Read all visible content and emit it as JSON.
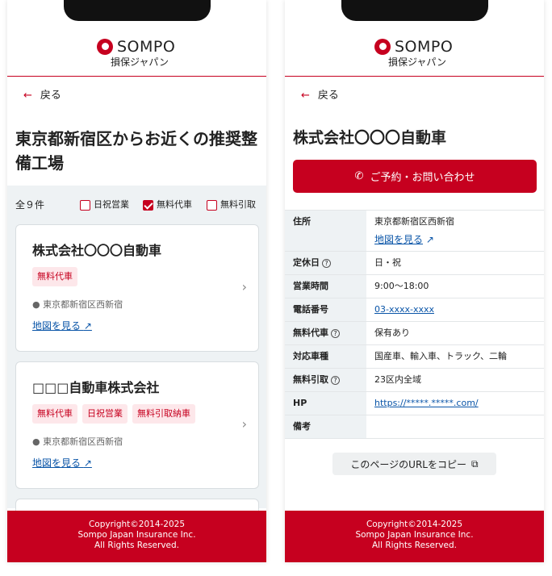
{
  "brand": {
    "name": "SOMPO",
    "sub": "損保ジャパン",
    "accent": "#c6001f"
  },
  "back_label": "戻る",
  "list": {
    "title": "東京都新宿区からお近くの推奨整備工場",
    "count": "全９件",
    "filters": [
      {
        "label": "日祝営業",
        "checked": false
      },
      {
        "label": "無料代車",
        "checked": true
      },
      {
        "label": "無料引取",
        "checked": false
      }
    ],
    "cards": [
      {
        "name": "株式会社〇〇〇自動車",
        "tags": [
          "無料代車"
        ],
        "location": "東京都新宿区西新宿",
        "map_link": "地図を見る"
      },
      {
        "name": "□□□自動車株式会社",
        "tags": [
          "無料代車",
          "日祝営業",
          "無料引取納車"
        ],
        "location": "東京都新宿区西新宿",
        "map_link": "地図を見る"
      }
    ]
  },
  "detail": {
    "title": "株式会社〇〇〇自動車",
    "reserve_button": "ご予約・お問い合わせ",
    "rows": [
      {
        "key": "住所",
        "value": "東京都新宿区西新宿",
        "link": "地図を見る"
      },
      {
        "key": "定休日",
        "value": "日・祝"
      },
      {
        "key": "営業時間",
        "value": "9:00～18:00"
      },
      {
        "key": "電話番号",
        "value": "03-xxxx-xxxx"
      },
      {
        "key": "無料代車",
        "value": "保有あり"
      },
      {
        "key": "対応車種",
        "value": "国産車、輸入車、トラック、二輪"
      },
      {
        "key": "無料引取",
        "value": "23区内全域"
      },
      {
        "key": "HP",
        "value": "https://*****.*****.com/"
      },
      {
        "key": "備考",
        "value": ""
      }
    ],
    "copy_button": "このページのURLをコピー"
  },
  "footer": {
    "line1": "Copyright©2014-2025",
    "line2": "Sompo Japan Insurance Inc.",
    "line3": "All Rights Reserved."
  }
}
